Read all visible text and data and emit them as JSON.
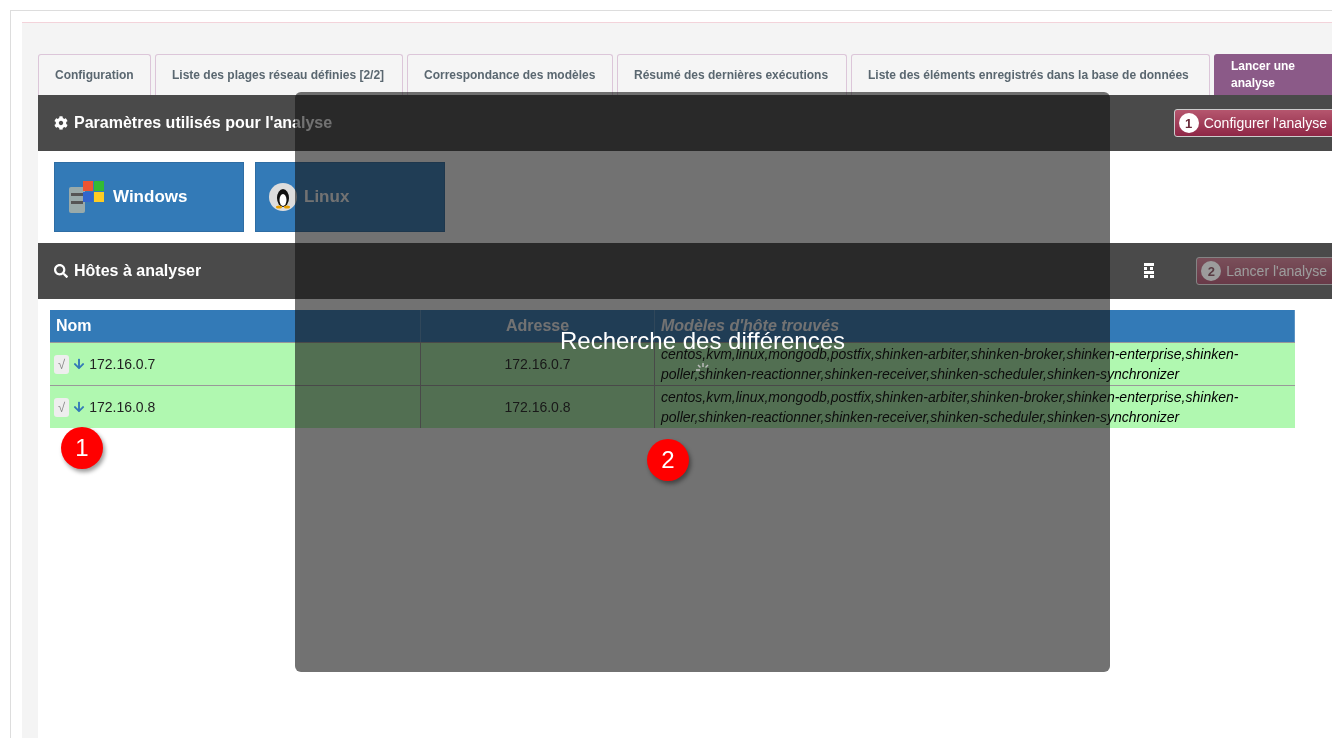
{
  "tabs": [
    {
      "label": "Configuration",
      "selected": false
    },
    {
      "label": "Liste des plages réseau définies [2/2]",
      "selected": false
    },
    {
      "label": "Correspondance des modèles",
      "selected": false
    },
    {
      "label": "Résumé des dernières exécutions",
      "selected": false
    },
    {
      "label": "Liste des éléments enregistrés dans la base de données",
      "selected": false
    },
    {
      "label": "Lancer une analyse",
      "selected": true
    }
  ],
  "params_panel": {
    "title": "Paramètres utilisés pour l'analyse",
    "button": {
      "badge": "1",
      "label": "Configurer l'analyse",
      "disabled": false
    }
  },
  "os_options": [
    {
      "label": "Windows",
      "kind": "windows"
    },
    {
      "label": "Linux",
      "kind": "linux"
    }
  ],
  "hosts_panel": {
    "title": "Hôtes à analyser",
    "button": {
      "badge": "2",
      "label": "Lancer l'analyse",
      "disabled": true
    }
  },
  "table": {
    "columns": [
      "Nom",
      "Adresse",
      "Modèles d'hôte trouvés"
    ],
    "rows": [
      {
        "mark": "√",
        "name": "172.16.0.7",
        "address": "172.16.0.7",
        "models": "centos,kvm,linux,mongodb,postfix,shinken-arbiter,shinken-broker,shinken-enterprise,shinken-poller,shinken-reactionner,shinken-receiver,shinken-scheduler,shinken-synchronizer"
      },
      {
        "mark": "√",
        "name": "172.16.0.8",
        "address": "172.16.0.8",
        "models": "centos,kvm,linux,mongodb,postfix,shinken-arbiter,shinken-broker,shinken-enterprise,shinken-poller,shinken-reactionner,shinken-receiver,shinken-scheduler,shinken-synchronizer"
      }
    ]
  },
  "overlay": {
    "message": "Recherche des différences"
  },
  "callouts": [
    "1",
    "2"
  ]
}
